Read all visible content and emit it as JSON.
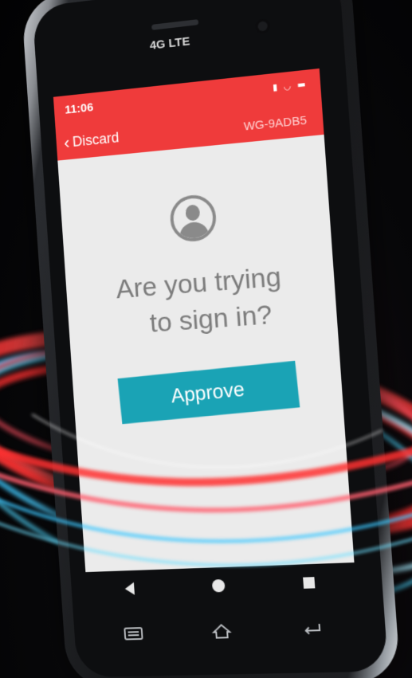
{
  "device": {
    "carrier_label": "4G LTE"
  },
  "statusbar": {
    "time": "11:06",
    "icons": [
      "signal-icon",
      "wifi-icon",
      "battery-icon"
    ]
  },
  "header": {
    "back_label": "Discard",
    "code": "WG-9ADB5"
  },
  "prompt": {
    "line1": "Are you trying",
    "line2": "to sign in?",
    "avatar_icon": "user-avatar-icon"
  },
  "actions": {
    "approve_label": "Approve"
  },
  "navigation": {
    "softkeys": [
      "back-triangle-icon",
      "home-circle-icon",
      "recent-square-icon"
    ],
    "hardware_keys": [
      "menu-icon",
      "home-icon",
      "return-icon"
    ]
  },
  "colors": {
    "header_red": "#ef3b3b",
    "approve_teal": "#1aa3b5",
    "screen_bg": "#ebebeb"
  }
}
